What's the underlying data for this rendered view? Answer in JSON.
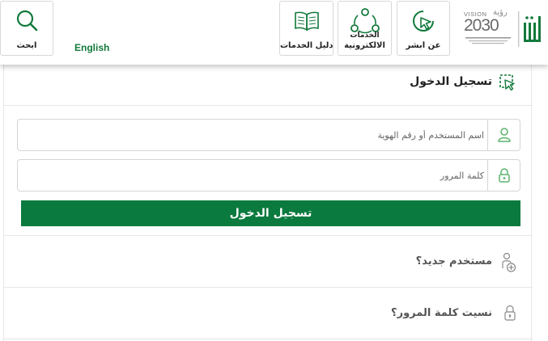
{
  "header": {
    "search_label": "ابحث",
    "language_link": "English",
    "services_guide_label": "دليل الخدمات",
    "eservices_label": "الالكترونية",
    "eservices_label_partial": "الخدمات",
    "about_label": "عن أبشر",
    "vision": {
      "word": "VISION",
      "word_ar": "رؤية",
      "year": "2030"
    },
    "icons": {
      "search": "search-icon",
      "guide": "book-icon",
      "eservices": "network-icon",
      "about": "cursor-circle-icon",
      "brand": "absher-logo"
    }
  },
  "login": {
    "title": "تسجيل الدخول",
    "username_placeholder": "اسم المستخدم أو رقم الهوية",
    "password_placeholder": "كلمة المرور",
    "submit_label": "تسجيل الدخول"
  },
  "links": {
    "new_user": "مستخدم جديد؟",
    "forgot_password": "نسيت كلمة المرور؟"
  },
  "colors": {
    "primary_green": "#0b7a3e",
    "accent_light_green": "#8fd19e",
    "border_gray": "#d5d5d5"
  }
}
